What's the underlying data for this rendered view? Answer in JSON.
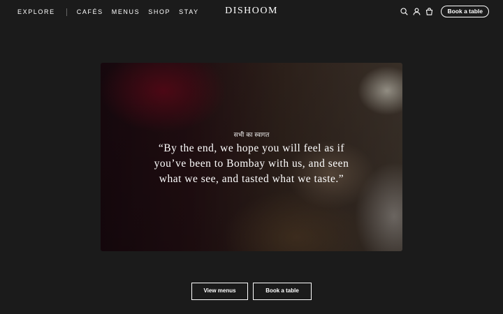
{
  "header": {
    "nav_left": {
      "explore": "EXPLORE",
      "cafes": "CAFÉS",
      "menus": "MENUS",
      "shop": "SHOP",
      "stay": "STAY"
    },
    "logo": "DISHOOM",
    "icons": [
      "search-icon",
      "account-icon",
      "basket-icon"
    ],
    "book_button": "Book a table"
  },
  "hero": {
    "subtitle": "सभी का स्वागत",
    "quote_lines": [
      "“By the end, we hope you will feel as if",
      "you’ve been to Bombay with us, and seen",
      "what we see, and tasted what we taste.”"
    ]
  },
  "cta": {
    "view_menus": "View menus",
    "book_table": "Book a table"
  },
  "colors": {
    "background": "#1b1b1b",
    "text": "#ffffff"
  }
}
